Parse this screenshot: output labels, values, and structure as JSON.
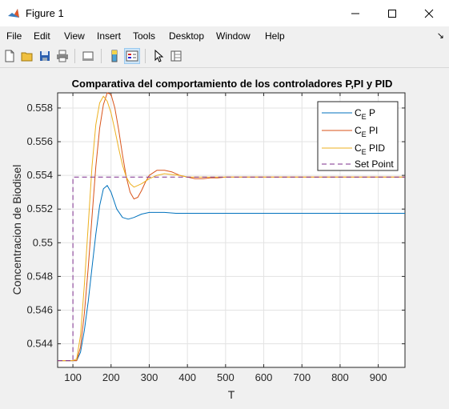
{
  "window": {
    "title": "Figure 1",
    "minimize_icon": "minimize-icon",
    "maximize_icon": "maximize-icon",
    "close_icon": "close-icon"
  },
  "menu": {
    "items": [
      "File",
      "Edit",
      "View",
      "Insert",
      "Tools",
      "Desktop",
      "Window",
      "Help"
    ]
  },
  "toolbar": {
    "icons": [
      "new-figure-icon",
      "open-file-icon",
      "save-icon",
      "print-icon",
      "link-plot-icon",
      "colorbar-icon",
      "legend-icon",
      "pointer-icon",
      "property-inspector-icon"
    ]
  },
  "chart_data": {
    "type": "line",
    "title": "Comparativa del comportamiento de los controladores P,PI y PID",
    "xlabel": "T",
    "ylabel": "Concentracion de Biodisel",
    "xlim": [
      60,
      970
    ],
    "ylim": [
      0.5426,
      0.5589
    ],
    "xticks": [
      100,
      200,
      300,
      400,
      500,
      600,
      700,
      800,
      900
    ],
    "xtick_labels": [
      "100",
      "200",
      "300",
      "400",
      "500",
      "600",
      "700",
      "800",
      "900"
    ],
    "yticks": [
      0.544,
      0.546,
      0.548,
      0.55,
      0.552,
      0.554,
      0.556,
      0.558
    ],
    "ytick_labels": [
      "0.544",
      "0.546",
      "0.548",
      "0.55",
      "0.552",
      "0.554",
      "0.556",
      "0.558"
    ],
    "grid": true,
    "legend_position": "top-right",
    "series": [
      {
        "name_main": "C",
        "name_sub": "E",
        "name_rest": " P",
        "color": "#0072bd",
        "dash": "",
        "x": [
          60,
          100,
          110,
          120,
          130,
          140,
          150,
          160,
          170,
          180,
          190,
          200,
          215,
          230,
          245,
          260,
          280,
          300,
          320,
          340,
          370,
          400,
          450,
          500,
          600,
          700,
          800,
          970
        ],
        "y": [
          0.543,
          0.543,
          0.543,
          0.5435,
          0.5448,
          0.5465,
          0.5485,
          0.5505,
          0.5522,
          0.5532,
          0.5534,
          0.553,
          0.552,
          0.5515,
          0.5514,
          0.5515,
          0.5517,
          0.5518,
          0.5518,
          0.5518,
          0.55175,
          0.55175,
          0.55175,
          0.55175,
          0.55175,
          0.55175,
          0.55175,
          0.55175
        ]
      },
      {
        "name_main": "C",
        "name_sub": "E",
        "name_rest": " PI",
        "color": "#d95319",
        "dash": "",
        "x": [
          60,
          100,
          110,
          120,
          130,
          140,
          150,
          160,
          170,
          180,
          190,
          200,
          210,
          220,
          230,
          240,
          250,
          260,
          270,
          280,
          290,
          300,
          320,
          340,
          360,
          380,
          400,
          420,
          440,
          460,
          480,
          500,
          520,
          540,
          560,
          580,
          600,
          650,
          700,
          800,
          970
        ],
        "y": [
          0.543,
          0.543,
          0.543,
          0.5438,
          0.5458,
          0.5485,
          0.5515,
          0.5545,
          0.5568,
          0.5582,
          0.5589,
          0.5588,
          0.558,
          0.5567,
          0.5552,
          0.5539,
          0.553,
          0.5526,
          0.5527,
          0.5531,
          0.5536,
          0.554,
          0.5543,
          0.5543,
          0.5542,
          0.554,
          0.5539,
          0.5538,
          0.5538,
          0.55385,
          0.55385,
          0.5539,
          0.5539,
          0.5539,
          0.5539,
          0.5539,
          0.5539,
          0.5539,
          0.5539,
          0.5539,
          0.5539
        ]
      },
      {
        "name_main": "C",
        "name_sub": "E",
        "name_rest": " PID",
        "color": "#edb120",
        "dash": "",
        "x": [
          60,
          100,
          110,
          120,
          130,
          140,
          150,
          160,
          170,
          180,
          190,
          200,
          210,
          220,
          230,
          240,
          250,
          260,
          270,
          280,
          300,
          320,
          340,
          360,
          380,
          400,
          420,
          440,
          460,
          480,
          500,
          540,
          600,
          700,
          800,
          970
        ],
        "y": [
          0.543,
          0.543,
          0.5431,
          0.5445,
          0.5475,
          0.551,
          0.5545,
          0.557,
          0.5583,
          0.5587,
          0.5584,
          0.5577,
          0.5567,
          0.5556,
          0.5546,
          0.5539,
          0.5535,
          0.5533,
          0.5534,
          0.5535,
          0.5538,
          0.554,
          0.5541,
          0.55405,
          0.554,
          0.5539,
          0.5539,
          0.5539,
          0.5539,
          0.5539,
          0.5539,
          0.5539,
          0.5539,
          0.5539,
          0.5539,
          0.5539
        ]
      },
      {
        "name_main": "Set Point",
        "name_sub": "",
        "name_rest": "",
        "color": "#7e2f8e",
        "dash": "6,4",
        "x": [
          60,
          100,
          100,
          970
        ],
        "y": [
          0.543,
          0.543,
          0.5539,
          0.5539
        ]
      }
    ]
  }
}
